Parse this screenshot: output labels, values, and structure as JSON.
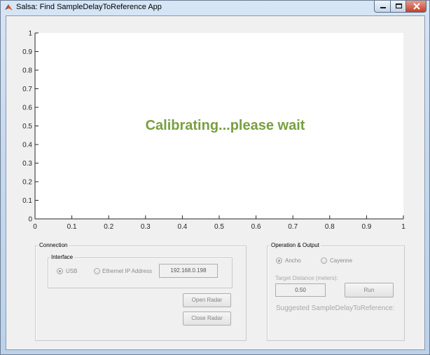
{
  "window": {
    "title": "Salsa: Find SampleDelayToReference App"
  },
  "axes": {
    "x_ticks": [
      "0",
      "0.1",
      "0.2",
      "0.3",
      "0.4",
      "0.5",
      "0.6",
      "0.7",
      "0.8",
      "0.9",
      "1"
    ],
    "y_ticks": [
      "0",
      "0.1",
      "0.2",
      "0.3",
      "0.4",
      "0.5",
      "0.6",
      "0.7",
      "0.8",
      "0.9",
      "1"
    ],
    "status_message": "Calibrating...please wait",
    "status_color": "#78a040"
  },
  "connection": {
    "title": "Connection",
    "interface": {
      "title": "Interface",
      "usb_label": "USB",
      "usb_selected": true,
      "ethernet_label": "Ethernet IP Address",
      "ethernet_selected": false,
      "ip_address": "192.168.0.198"
    },
    "open_radar_label": "Open Radar",
    "close_radar_label": "Close Radar"
  },
  "operation": {
    "title": "Operation & Output",
    "ancho_label": "Ancho",
    "ancho_selected": true,
    "cayenne_label": "Cayenne",
    "cayenne_selected": false,
    "target_distance_label": "Target Distance (meters):",
    "target_distance_value": "0.50",
    "run_label": "Run",
    "suggested_label": "Suggested SampleDelayToReference:"
  }
}
